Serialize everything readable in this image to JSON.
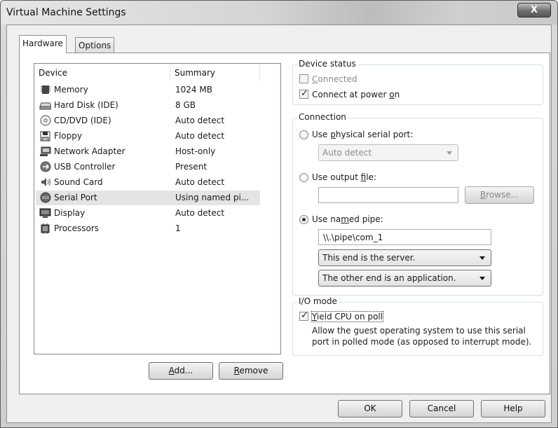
{
  "window": {
    "title": "Virtual Machine Settings",
    "close_glyph": "X"
  },
  "tabs": [
    {
      "label": "Hardware",
      "active": true
    },
    {
      "label": "Options",
      "active": false
    }
  ],
  "device_list": {
    "headers": {
      "device": "Device",
      "summary": "Summary"
    },
    "rows": [
      {
        "name": "Memory",
        "summary": "1024 MB",
        "icon": "memory-icon"
      },
      {
        "name": "Hard Disk (IDE)",
        "summary": "8 GB",
        "icon": "hard-disk-icon"
      },
      {
        "name": "CD/DVD (IDE)",
        "summary": "Auto detect",
        "icon": "cd-dvd-icon"
      },
      {
        "name": "Floppy",
        "summary": "Auto detect",
        "icon": "floppy-icon"
      },
      {
        "name": "Network Adapter",
        "summary": "Host-only",
        "icon": "network-adapter-icon"
      },
      {
        "name": "USB Controller",
        "summary": "Present",
        "icon": "usb-icon"
      },
      {
        "name": "Sound Card",
        "summary": "Auto detect",
        "icon": "sound-card-icon"
      },
      {
        "name": "Serial Port",
        "summary": "Using named pi...",
        "icon": "serial-port-icon",
        "selected": true
      },
      {
        "name": "Display",
        "summary": "Auto detect",
        "icon": "display-icon"
      },
      {
        "name": "Processors",
        "summary": "1",
        "icon": "processor-icon"
      }
    ]
  },
  "buttons": {
    "add": {
      "pre": "",
      "key": "A",
      "post": "dd..."
    },
    "remove": {
      "pre": "",
      "key": "R",
      "post": "emove"
    },
    "ok": "OK",
    "cancel": "Cancel",
    "help": "Help"
  },
  "device_status": {
    "title": "Device status",
    "connected": {
      "pre": "",
      "key": "C",
      "post": "onnected",
      "checked": false,
      "enabled": false
    },
    "connect_at_power_on": {
      "pre": "Connect at power ",
      "key": "o",
      "post": "n",
      "checked": true
    }
  },
  "connection": {
    "title": "Connection",
    "physical": {
      "pre": "Use ",
      "key": "p",
      "post": "hysical serial port:",
      "selected": false
    },
    "physical_combo": "Auto detect",
    "output": {
      "pre": "Use output ",
      "key": "f",
      "post": "ile:",
      "selected": false
    },
    "output_value": "",
    "browse": {
      "pre": "",
      "key": "B",
      "post": "rowse..."
    },
    "named_pipe": {
      "pre": "Use na",
      "key": "m",
      "post": "ed pipe:",
      "selected": true
    },
    "pipe_path": "\\\\.\\pipe\\com_1",
    "end_combo": "This end is the server.",
    "other_combo": "The other end is an application."
  },
  "io_mode": {
    "title": "I/O mode",
    "yield": {
      "pre": "",
      "key": "Y",
      "post": "ield CPU on poll",
      "checked": true
    },
    "description": [
      "Allow the guest operating system to use this serial",
      "port in polled mode (as opposed to interrupt mode)."
    ]
  }
}
